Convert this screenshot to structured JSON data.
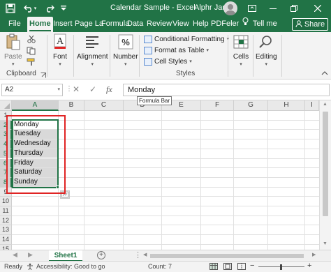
{
  "window": {
    "title": "Calendar Sample  -  Excel",
    "user": "Alphr Jan"
  },
  "ribbon_tabs": [
    "File",
    "Home",
    "Insert",
    "Page La",
    "Formula",
    "Data",
    "Review",
    "View",
    "Help",
    "PDFeler"
  ],
  "tell_me": "Tell me",
  "share_label": "Share",
  "ribbon": {
    "paste_label": "Paste",
    "clipboard_label": "Clipboard",
    "font_label": "Font",
    "alignment_label": "Alignment",
    "number_label": "Number",
    "conditional_formatting": "Conditional Formatting",
    "format_as_table": "Format as Table",
    "cell_styles": "Cell Styles",
    "styles_label": "Styles",
    "cells_label": "Cells",
    "editing_label": "Editing"
  },
  "formula_bar": {
    "name_box": "A2",
    "value": "Monday",
    "tooltip": "Formula Bar"
  },
  "columns": [
    "A",
    "B",
    "C",
    "D",
    "E",
    "F",
    "G",
    "H",
    "I"
  ],
  "rows": [
    "1",
    "2",
    "3",
    "4",
    "5",
    "6",
    "7",
    "8",
    "9",
    "10",
    "11",
    "12",
    "13",
    "14",
    "15"
  ],
  "cells": [
    "Monday",
    "Tuesday",
    "Wednesday",
    "Thursday",
    "Friday",
    "Saturday",
    "Sunday"
  ],
  "sheet_tab": "Sheet1",
  "status": {
    "ready": "Ready",
    "accessibility": "Accessibility: Good to go",
    "count": "Count: 7"
  },
  "colors": {
    "excel_green": "#217346",
    "selection_fill": "#d9d9d9",
    "highlight_red": "#e02424"
  }
}
